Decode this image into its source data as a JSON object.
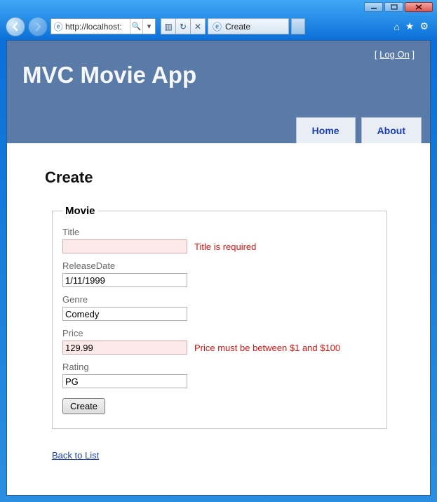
{
  "browser": {
    "url_display": "http://localhost:",
    "tab_title": "Create"
  },
  "site": {
    "logon_label": "Log On",
    "title": "MVC Movie App",
    "menu": {
      "home": "Home",
      "about": "About"
    }
  },
  "page": {
    "heading": "Create",
    "fieldset_legend": "Movie",
    "back_link": "Back to List",
    "submit_label": "Create"
  },
  "form": {
    "title": {
      "label": "Title",
      "value": "",
      "error": "Title is required"
    },
    "release_date": {
      "label": "ReleaseDate",
      "value": "1/11/1999",
      "error": ""
    },
    "genre": {
      "label": "Genre",
      "value": "Comedy",
      "error": ""
    },
    "price": {
      "label": "Price",
      "value": "129.99",
      "error": "Price must be between $1 and $100"
    },
    "rating": {
      "label": "Rating",
      "value": "PG",
      "error": ""
    }
  }
}
